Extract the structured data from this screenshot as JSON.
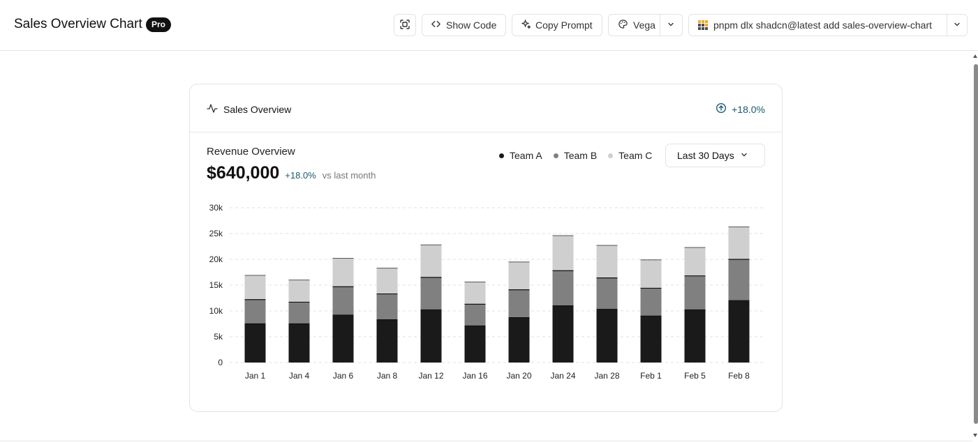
{
  "header": {
    "title": "Sales Overview Chart",
    "badge": "Pro",
    "show_code_label": "Show Code",
    "copy_prompt_label": "Copy Prompt",
    "theme_label": "Vega",
    "command": "pnpm dlx shadcn@latest add sales-overview-chart"
  },
  "card": {
    "title": "Sales Overview",
    "change": "+18.0%",
    "revenue_label": "Revenue Overview",
    "revenue_value": "$640,000",
    "revenue_change": "+18.0%",
    "revenue_compare": "vs last month",
    "range_label": "Last 30 Days"
  },
  "icons": {
    "fit": "focus-frame-icon",
    "code": "code-brackets-icon",
    "copy": "sparkles-icon",
    "theme": "palette-icon",
    "chevron": "chevron-down-icon",
    "package": "pnpm-logo-icon",
    "activity": "activity-pulse-icon",
    "trend": "arrow-up-circle-icon"
  },
  "colors": {
    "team_a": "#1a1a1a",
    "team_b": "#808080",
    "team_c": "#cfcfcf",
    "accent": "#1a5a6e"
  },
  "chart_data": {
    "type": "bar",
    "stacked": true,
    "categories": [
      "Jan 1",
      "Jan 4",
      "Jan 6",
      "Jan 8",
      "Jan 12",
      "Jan 16",
      "Jan 20",
      "Jan 24",
      "Jan 28",
      "Feb 1",
      "Feb 5",
      "Feb 8"
    ],
    "series": [
      {
        "name": "Team A",
        "color": "#1a1a1a",
        "values": [
          7500,
          7500,
          9200,
          8300,
          10200,
          7100,
          8700,
          11000,
          10300,
          9000,
          10200,
          12000
        ]
      },
      {
        "name": "Team B",
        "color": "#808080",
        "values": [
          4700,
          4200,
          5500,
          5000,
          6300,
          4200,
          5400,
          6800,
          6100,
          5400,
          6600,
          8000
        ]
      },
      {
        "name": "Team C",
        "color": "#cfcfcf",
        "values": [
          4700,
          4300,
          5500,
          5000,
          6300,
          4300,
          5400,
          6800,
          6300,
          5500,
          5500,
          6300
        ]
      }
    ],
    "y_ticks": [
      "0",
      "5k",
      "10k",
      "15k",
      "20k",
      "25k",
      "30k"
    ],
    "y_tick_values": [
      0,
      5000,
      10000,
      15000,
      20000,
      25000,
      30000
    ],
    "ylim": [
      0,
      30000
    ],
    "grid": true,
    "legend_position": "top-right",
    "title": "",
    "xlabel": "",
    "ylabel": ""
  }
}
